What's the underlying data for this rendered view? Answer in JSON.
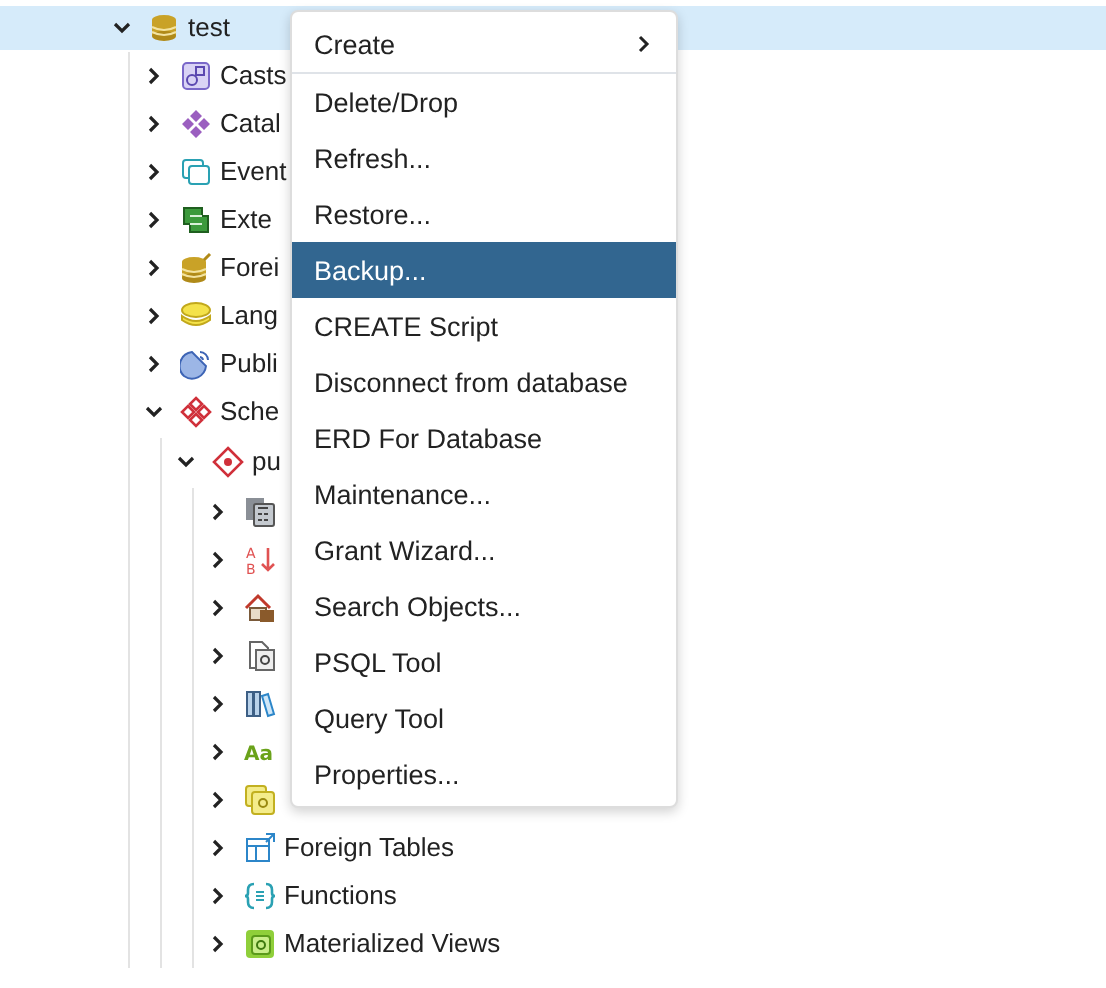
{
  "tree": [
    {
      "label": "test",
      "kind": "database",
      "expanded": true,
      "selected": true,
      "children": [
        {
          "label": "Casts",
          "kind": "casts",
          "expanded": false,
          "selected": false
        },
        {
          "label": "Catal",
          "kind": "catalogs",
          "expanded": false,
          "selected": false
        },
        {
          "label": "Event",
          "kind": "events",
          "expanded": false,
          "selected": false
        },
        {
          "label": "Exte",
          "kind": "extensions",
          "expanded": false,
          "selected": false
        },
        {
          "label": "Forei",
          "kind": "foreign-data",
          "expanded": false,
          "selected": false
        },
        {
          "label": "Lang",
          "kind": "languages",
          "expanded": false,
          "selected": false
        },
        {
          "label": "Publi",
          "kind": "publications",
          "expanded": false,
          "selected": false
        },
        {
          "label": "Sche",
          "kind": "schemas",
          "expanded": true,
          "selected": false,
          "children": [
            {
              "label": "pu",
              "kind": "schema",
              "expanded": true,
              "selected": false,
              "children": [
                {
                  "kind": "aggregates",
                  "expanded": false,
                  "selected": false
                },
                {
                  "kind": "collations",
                  "icon_text": [
                    "A",
                    "B"
                  ],
                  "expanded": false,
                  "selected": false
                },
                {
                  "kind": "domains",
                  "expanded": false,
                  "selected": false
                },
                {
                  "kind": "fts-config",
                  "expanded": false,
                  "selected": false
                },
                {
                  "kind": "fts-dict",
                  "expanded": false,
                  "selected": false
                },
                {
                  "kind": "fts-parser",
                  "icon_text": [
                    "Aa"
                  ],
                  "expanded": false,
                  "selected": false
                },
                {
                  "kind": "fts-template",
                  "expanded": false,
                  "selected": false
                },
                {
                  "label": "Foreign Tables",
                  "kind": "foreign-tables",
                  "expanded": false,
                  "selected": false
                },
                {
                  "label": "Functions",
                  "kind": "functions",
                  "expanded": false,
                  "selected": false
                },
                {
                  "label": "Materialized Views",
                  "kind": "mat-views",
                  "expanded": false,
                  "selected": false
                }
              ]
            }
          ]
        }
      ]
    }
  ],
  "context_menu": [
    {
      "label": "Create",
      "selected": false,
      "submenu": true,
      "separator_after": true
    },
    {
      "label": "Delete/Drop",
      "selected": false
    },
    {
      "label": "Refresh...",
      "selected": false
    },
    {
      "label": "Restore...",
      "selected": false
    },
    {
      "label": "Backup...",
      "selected": true
    },
    {
      "label": "CREATE Script",
      "selected": false
    },
    {
      "label": "Disconnect from database",
      "selected": false
    },
    {
      "label": "ERD For Database",
      "selected": false
    },
    {
      "label": "Maintenance...",
      "selected": false
    },
    {
      "label": "Grant Wizard...",
      "selected": false
    },
    {
      "label": "Search Objects...",
      "selected": false
    },
    {
      "label": "PSQL Tool",
      "selected": false
    },
    {
      "label": "Query Tool",
      "selected": false
    },
    {
      "label": "Properties...",
      "selected": false
    }
  ]
}
